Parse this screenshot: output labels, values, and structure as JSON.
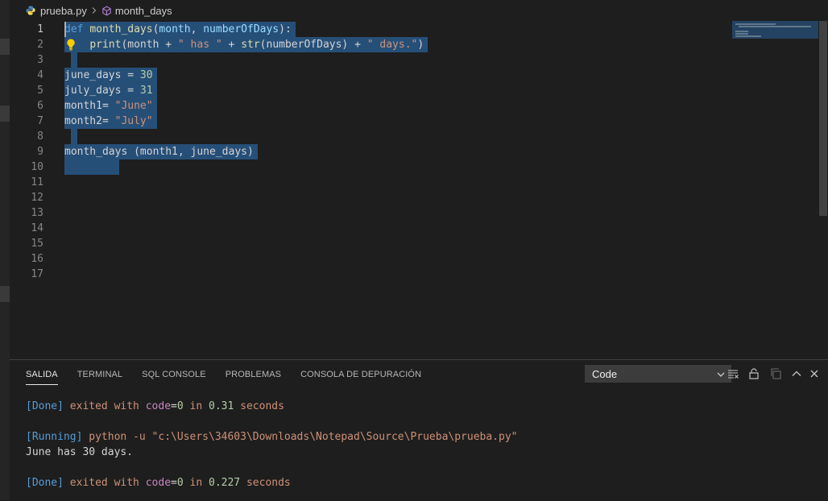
{
  "breadcrumb": {
    "file": "prueba.py",
    "symbol": "month_days"
  },
  "editor": {
    "lines": [
      {
        "n": "1",
        "tokens": [
          [
            "kw",
            "def"
          ],
          [
            "plain",
            " "
          ],
          [
            "fn",
            "month_days"
          ],
          [
            "plain",
            "("
          ],
          [
            "par",
            "month"
          ],
          [
            "plain",
            ", "
          ],
          [
            "par",
            "numberOfDays"
          ],
          [
            "plain",
            "):"
          ]
        ]
      },
      {
        "n": "2",
        "tokens": [
          [
            "plain",
            "    "
          ],
          [
            "fn",
            "print"
          ],
          [
            "plain",
            "(month + "
          ],
          [
            "str",
            "\" has \""
          ],
          [
            "plain",
            " + "
          ],
          [
            "fn",
            "str"
          ],
          [
            "plain",
            "(numberOfDays) + "
          ],
          [
            "str",
            "\" days.\""
          ],
          [
            "plain",
            ")"
          ]
        ]
      },
      {
        "n": "3",
        "tokens": []
      },
      {
        "n": "4",
        "tokens": [
          [
            "plain",
            "june_days = "
          ],
          [
            "num",
            "30"
          ]
        ]
      },
      {
        "n": "5",
        "tokens": [
          [
            "plain",
            "july_days = "
          ],
          [
            "num",
            "31"
          ]
        ]
      },
      {
        "n": "6",
        "tokens": [
          [
            "plain",
            "month1= "
          ],
          [
            "str",
            "\"June\""
          ]
        ]
      },
      {
        "n": "7",
        "tokens": [
          [
            "plain",
            "month2= "
          ],
          [
            "str",
            "\"July\""
          ]
        ]
      },
      {
        "n": "8",
        "tokens": []
      },
      {
        "n": "9",
        "tokens": [
          [
            "plain",
            "month_days (month1, june_days)"
          ]
        ]
      },
      {
        "n": "10",
        "tokens": [
          [
            "plain",
            "        "
          ]
        ]
      },
      {
        "n": "11",
        "tokens": null
      },
      {
        "n": "12",
        "tokens": null
      },
      {
        "n": "13",
        "tokens": null
      },
      {
        "n": "14",
        "tokens": null
      },
      {
        "n": "15",
        "tokens": null
      },
      {
        "n": "16",
        "tokens": null
      },
      {
        "n": "17",
        "tokens": null
      }
    ]
  },
  "panel": {
    "tabs": [
      "SALIDA",
      "TERMINAL",
      "SQL CONSOLE",
      "PROBLEMAS",
      "CONSOLA DE DEPURACIÓN"
    ],
    "channel": "Code",
    "output": [
      [
        [
          "tag",
          "[Done]"
        ],
        [
          "txt",
          " exited with "
        ],
        [
          "kw",
          "code"
        ],
        [
          "plain",
          "="
        ],
        [
          "num",
          "0"
        ],
        [
          "txt",
          " in "
        ],
        [
          "num",
          "0.31"
        ],
        [
          "txt",
          " seconds"
        ]
      ],
      [],
      [
        [
          "tag",
          "[Running]"
        ],
        [
          "txt",
          " python -u \"c:\\Users\\34603\\Downloads\\Notepad\\Source\\Prueba\\prueba.py\""
        ]
      ],
      [
        [
          "plain",
          "June has 30 days."
        ]
      ],
      [],
      [
        [
          "tag",
          "[Done]"
        ],
        [
          "txt",
          " exited with "
        ],
        [
          "kw",
          "code"
        ],
        [
          "plain",
          "="
        ],
        [
          "num",
          "0"
        ],
        [
          "txt",
          " in "
        ],
        [
          "num",
          "0.227"
        ],
        [
          "txt",
          " seconds"
        ]
      ]
    ]
  },
  "colors": {
    "selection": "#264f78",
    "editor_bg": "#1e1e1e",
    "keyword": "#569cd6",
    "function": "#dcdcaa",
    "string": "#ce9178",
    "number": "#b5cea8"
  },
  "icons": [
    "python-file-icon",
    "chevron-right-icon",
    "symbol-method-icon",
    "lightbulb-icon",
    "chevron-down-icon",
    "clear-output-icon",
    "lock-icon",
    "copy-icon",
    "maximize-panel-icon",
    "close-panel-icon"
  ]
}
